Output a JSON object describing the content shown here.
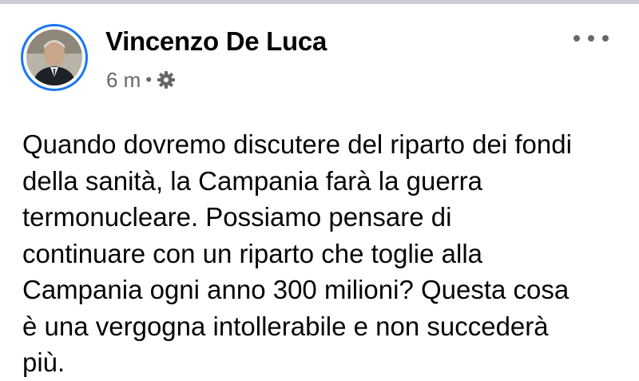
{
  "post": {
    "author": "Vincenzo De Luca",
    "timestamp": "6 m",
    "separator": "•",
    "privacy_icon": "gear-icon",
    "more_icon": "more-options-icon",
    "text_lines": [
      "Quando dovremo discutere del riparto dei fondi",
      "della sanità, la Campania farà la guerra",
      "termonucleare. Possiamo pensare di",
      "continuare con un riparto che toglie alla",
      "Campania ogni anno 300 milioni? Questa cosa",
      "è una vergogna intollerabile e non succederà",
      "più."
    ]
  },
  "colors": {
    "avatar_ring": "#1877f2",
    "meta_text": "#65676b",
    "body_text": "#050505"
  }
}
